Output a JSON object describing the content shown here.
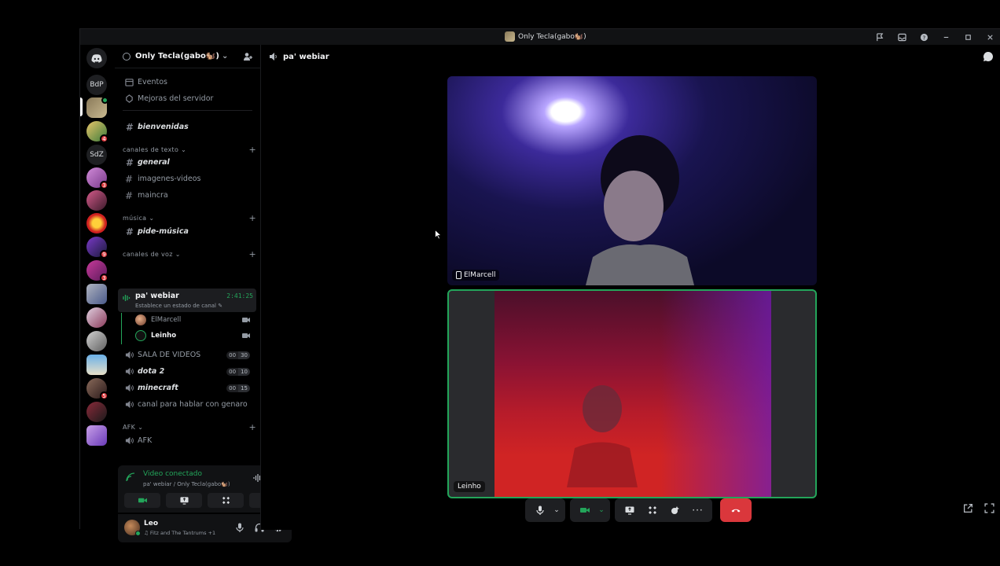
{
  "window": {
    "title": "Only Tecla(gabo🐿️)"
  },
  "rail": {
    "items": [
      {
        "label": "BdP",
        "badge": ""
      },
      {
        "label": "",
        "badge": ""
      },
      {
        "label": "",
        "badge": "4"
      },
      {
        "label": "SdZ",
        "badge": ""
      },
      {
        "label": "",
        "badge": "3"
      },
      {
        "label": "",
        "badge": ""
      },
      {
        "label": "",
        "badge": ""
      },
      {
        "label": "",
        "badge": "9"
      },
      {
        "label": "",
        "badge": "3"
      },
      {
        "label": "",
        "badge": ""
      },
      {
        "label": "",
        "badge": ""
      },
      {
        "label": "",
        "badge": ""
      },
      {
        "label": "",
        "badge": ""
      },
      {
        "label": "",
        "badge": "5"
      },
      {
        "label": "",
        "badge": ""
      },
      {
        "label": "",
        "badge": ""
      }
    ]
  },
  "server": {
    "name": "Only Tecla(gabo🐿️)",
    "events": "Eventos",
    "boosts": "Mejoras del servidor",
    "welcome": "bienvenidas",
    "categories": {
      "text": "canales de texto",
      "music": "música",
      "voice": "canales de voz",
      "afk": "AFK"
    },
    "text_channels": [
      "general",
      "imagenes-videos",
      "maincra"
    ],
    "music_channels": [
      "pide-música"
    ],
    "active_voice": {
      "name": "pa' webiar",
      "status": "Establece un estado de canal",
      "timer": "2:41:25",
      "users": [
        "ElMarcell",
        "Leinho"
      ]
    },
    "voice_channels": [
      {
        "name": "SALA DE VIDEOS",
        "a": "00",
        "b": "30"
      },
      {
        "name": "dota 2",
        "a": "00",
        "b": "10"
      },
      {
        "name": "minecraft",
        "a": "00",
        "b": "15"
      },
      {
        "name": "canal para hablar con genaro",
        "a": "",
        "b": ""
      }
    ],
    "afk_channels": [
      "AFK"
    ]
  },
  "connection": {
    "status": "Video conectado",
    "location": "pa' webiar / Only Tecla(gabo🐿️)"
  },
  "user": {
    "name": "Leo",
    "activity": "Fitz and The Tantrums +1"
  },
  "main": {
    "channel": "pa' webiar",
    "tiles": [
      {
        "name": "ElMarcell",
        "device": "mobile-icon"
      },
      {
        "name": "Leinho",
        "device": ""
      }
    ]
  },
  "colors": {
    "accent_green": "#23a55a",
    "danger": "#da373c",
    "bg": "#000000"
  }
}
